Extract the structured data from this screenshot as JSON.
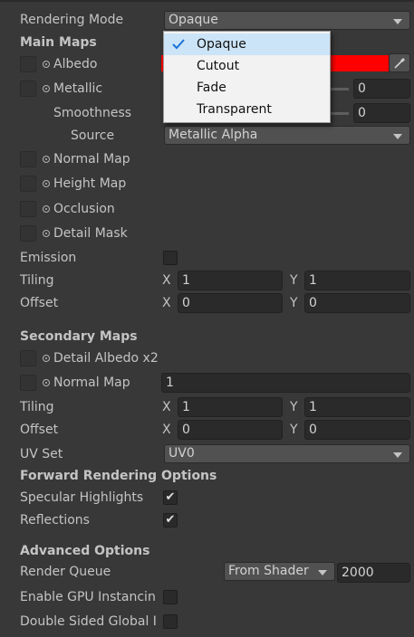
{
  "rendering_mode": {
    "label": "Rendering Mode",
    "value": "Opaque"
  },
  "menu": {
    "items": [
      "Opaque",
      "Cutout",
      "Fade",
      "Transparent"
    ],
    "selected": "Opaque",
    "check_icon": "checkmark-icon"
  },
  "main_maps": {
    "title": "Main Maps",
    "albedo": {
      "label": "Albedo",
      "color": "#ff0000"
    },
    "metallic": {
      "label": "Metallic",
      "value": "0"
    },
    "smoothness": {
      "label": "Smoothness",
      "value": "0"
    },
    "source": {
      "label": "Source",
      "value": "Metallic Alpha"
    },
    "normal_map": {
      "label": "Normal Map"
    },
    "height_map": {
      "label": "Height Map"
    },
    "occlusion": {
      "label": "Occlusion"
    },
    "detail_mask": {
      "label": "Detail Mask"
    },
    "emission": {
      "label": "Emission"
    },
    "tiling": {
      "label": "Tiling",
      "x_label": "X",
      "x": "1",
      "y_label": "Y",
      "y": "1"
    },
    "offset": {
      "label": "Offset",
      "x_label": "X",
      "x": "0",
      "y_label": "Y",
      "y": "0"
    }
  },
  "secondary_maps": {
    "title": "Secondary Maps",
    "detail_albedo": {
      "label": "Detail Albedo x2"
    },
    "normal_map": {
      "label": "Normal Map",
      "value": "1"
    },
    "tiling": {
      "label": "Tiling",
      "x_label": "X",
      "x": "1",
      "y_label": "Y",
      "y": "1"
    },
    "offset": {
      "label": "Offset",
      "x_label": "X",
      "x": "0",
      "y_label": "Y",
      "y": "0"
    },
    "uv_set": {
      "label": "UV Set",
      "value": "UV0"
    }
  },
  "forward": {
    "title": "Forward Rendering Options",
    "specular": {
      "label": "Specular Highlights",
      "checked": true
    },
    "reflections": {
      "label": "Reflections",
      "checked": true
    }
  },
  "advanced": {
    "title": "Advanced Options",
    "render_queue": {
      "label": "Render Queue",
      "mode": "From Shader",
      "value": "2000"
    },
    "gpu_instancing": {
      "label": "Enable GPU Instancin"
    },
    "double_sided": {
      "label": "Double Sided Global I"
    }
  },
  "check_glyph": "✔"
}
